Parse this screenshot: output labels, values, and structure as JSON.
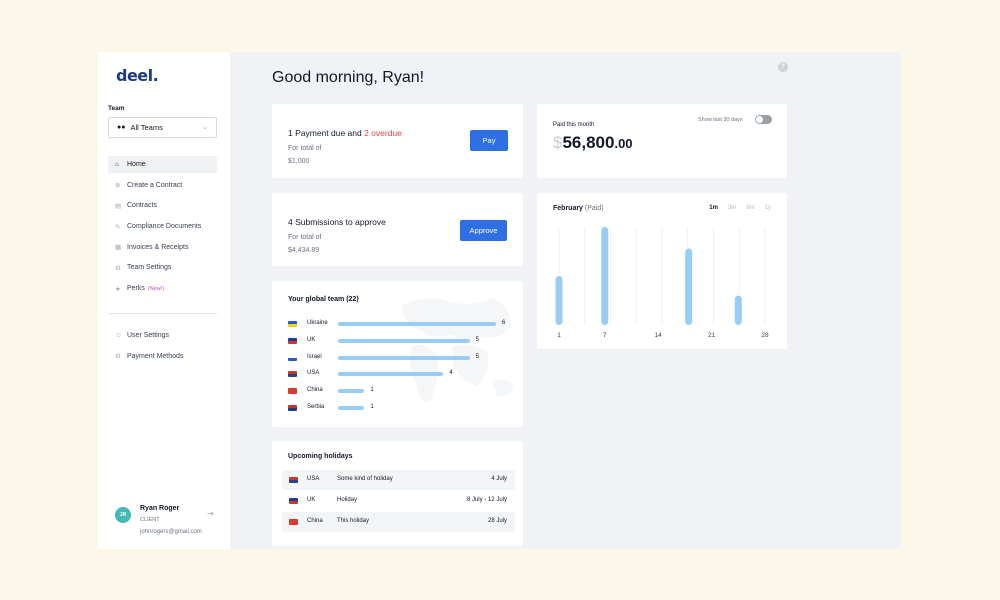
{
  "sidebar": {
    "logo": "deel.",
    "team_label": "Team",
    "team_select": "All Teams",
    "nav": [
      {
        "label": "Home",
        "icon": "home-icon"
      },
      {
        "label": "Create a Contract",
        "icon": "plus-circle-icon"
      },
      {
        "label": "Contracts",
        "icon": "document-icon"
      },
      {
        "label": "Compliance Documents",
        "icon": "pen-icon"
      },
      {
        "label": "Invoices & Receipts",
        "icon": "receipt-icon"
      },
      {
        "label": "Team Settings",
        "icon": "gear-icon"
      },
      {
        "label": "Perks",
        "icon": "star-icon",
        "badge": "(New!)"
      }
    ],
    "nav2": [
      {
        "label": "User Settings",
        "icon": "user-icon"
      },
      {
        "label": "Payment Methods",
        "icon": "card-icon"
      }
    ],
    "user": {
      "initials": "JR",
      "name": "Ryan Roger",
      "role": "CLIENT",
      "email": "johnrogers@gmail.com"
    }
  },
  "main": {
    "greeting": "Good morning, Ryan!",
    "payment": {
      "title_prefix": "1 Payment due and ",
      "title_overdue": "2 overdue",
      "sub_label": "For total of",
      "amount": "$1,000",
      "button": "Pay"
    },
    "paid": {
      "label": "Paid this month",
      "currency": "$",
      "amount": "56,800",
      "cents": ".00",
      "toggle_label": "Show last 30 days"
    },
    "submissions": {
      "title": "4 Submissions to approve",
      "sub_label": "For total of",
      "amount": "$4,434.89",
      "button": "Approve"
    },
    "team": {
      "title": "Your global team (22)",
      "rows": [
        {
          "country": "Ukraine",
          "count": 6
        },
        {
          "country": "UK",
          "count": 5
        },
        {
          "country": "Israel",
          "count": 5
        },
        {
          "country": "USA",
          "count": 4
        },
        {
          "country": "China",
          "count": 1
        },
        {
          "country": "Serbia",
          "count": 1
        }
      ]
    },
    "holidays": {
      "title": "Upcoming holidays",
      "rows": [
        {
          "country": "USA",
          "name": "Some kind of holiday",
          "date": "4 July"
        },
        {
          "country": "UK",
          "name": "Holiday",
          "date": "8 July - 12 July"
        },
        {
          "country": "China",
          "name": "This holiday",
          "date": "28 July"
        }
      ]
    }
  },
  "chart": {
    "title": "February",
    "title_tag": "(Paid)",
    "ranges": [
      "1m",
      "3m",
      "6m",
      "1y"
    ],
    "active_range": "1m"
  },
  "chart_data": {
    "type": "bar",
    "x_ticks": [
      1,
      7,
      14,
      21,
      28
    ],
    "x_range": [
      1,
      28
    ],
    "y_range": [
      0,
      100
    ],
    "bars": [
      {
        "x": 1,
        "y": 50
      },
      {
        "x": 7,
        "y": 100
      },
      {
        "x": 18,
        "y": 78
      },
      {
        "x": 24.5,
        "y": 30
      }
    ],
    "bar_color": "#98cdf5",
    "grid_x": true
  },
  "colors": {
    "accent": "#2f6fe4",
    "overdue": "#ef4444",
    "bar": "#98cdf5",
    "avatar": "#45b8b8",
    "perks_badge": "#c04ab8"
  }
}
